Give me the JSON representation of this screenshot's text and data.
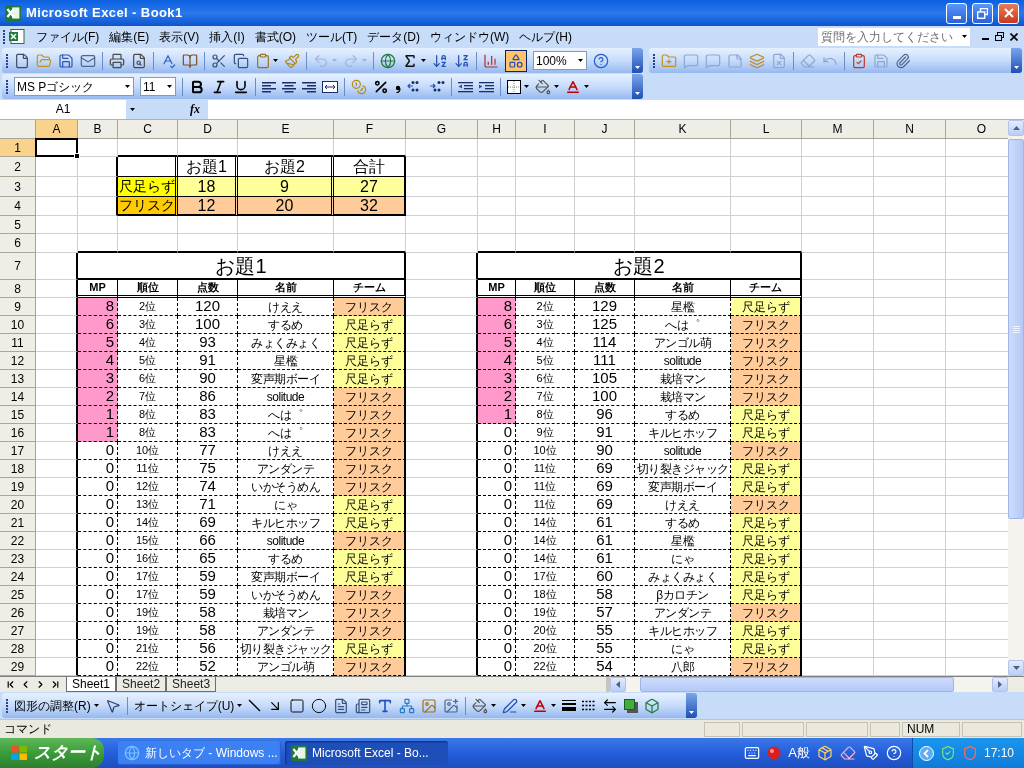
{
  "window": {
    "title": "Microsoft Excel - Book1"
  },
  "menu_bar": {
    "items": [
      "ファイル(F)",
      "編集(E)",
      "表示(V)",
      "挿入(I)",
      "書式(O)",
      "ツール(T)",
      "データ(D)",
      "ウィンドウ(W)",
      "ヘルプ(H)"
    ],
    "help_search": {
      "placeholder": "質問を入力してください"
    }
  },
  "standard_toolbar": {
    "zoom": "100%",
    "drawing_on": true,
    "undo_disabled": true,
    "redo_disabled": true
  },
  "formatting_toolbar": {
    "font": "MS Pゴシック",
    "size": "11"
  },
  "formula_bar": {
    "name_box": "A1",
    "function_label": "fx"
  },
  "sheet": {
    "columns": [
      {
        "label": "A",
        "selected": true
      },
      {
        "label": "B",
        "selected": false
      },
      {
        "label": "C",
        "selected": false
      },
      {
        "label": "D",
        "selected": false
      },
      {
        "label": "E",
        "selected": false
      },
      {
        "label": "F",
        "selected": false
      },
      {
        "label": "G",
        "selected": false
      },
      {
        "label": "H",
        "selected": false
      },
      {
        "label": "I",
        "selected": false
      },
      {
        "label": "J",
        "selected": false
      },
      {
        "label": "K",
        "selected": false
      },
      {
        "label": "L",
        "selected": false
      },
      {
        "label": "M",
        "selected": false
      },
      {
        "label": "N",
        "selected": false
      },
      {
        "label": "O",
        "selected": false
      }
    ],
    "rows": [
      {
        "label": "1",
        "selected": true
      },
      {
        "label": "2",
        "selected": false
      },
      {
        "label": "3",
        "selected": false
      },
      {
        "label": "4",
        "selected": false
      },
      {
        "label": "5",
        "selected": false
      },
      {
        "label": "6",
        "selected": false
      },
      {
        "label": "7",
        "selected": false
      },
      {
        "label": "8",
        "selected": false
      },
      {
        "label": "9",
        "selected": false
      },
      {
        "label": "10",
        "selected": false
      },
      {
        "label": "11",
        "selected": false
      },
      {
        "label": "12",
        "selected": false
      },
      {
        "label": "13",
        "selected": false
      },
      {
        "label": "14",
        "selected": false
      },
      {
        "label": "15",
        "selected": false
      },
      {
        "label": "16",
        "selected": false
      },
      {
        "label": "17",
        "selected": false
      },
      {
        "label": "18",
        "selected": false
      },
      {
        "label": "19",
        "selected": false
      },
      {
        "label": "20",
        "selected": false
      },
      {
        "label": "21",
        "selected": false
      },
      {
        "label": "22",
        "selected": false
      },
      {
        "label": "23",
        "selected": false
      },
      {
        "label": "24",
        "selected": false
      },
      {
        "label": "25",
        "selected": false
      },
      {
        "label": "26",
        "selected": false
      },
      {
        "label": "27",
        "selected": false
      },
      {
        "label": "28",
        "selected": false
      },
      {
        "label": "29",
        "selected": false
      }
    ]
  },
  "summary": {
    "headers": [
      "お題1",
      "お題2",
      "合計"
    ],
    "rows": [
      {
        "label": {
          "text": "尺足らず",
          "color": "#ffff00"
        },
        "color": "#ffff99",
        "values": [
          "18",
          "9",
          "27"
        ]
      },
      {
        "label": {
          "text": "フリスク",
          "color": "#ffcc00"
        },
        "color": "#ffcc99",
        "values": [
          "12",
          "20",
          "32"
        ]
      }
    ]
  },
  "rank_tables": [
    {
      "title": "お題1",
      "columns": [
        "MP",
        "順位",
        "点数",
        "名前",
        "チーム"
      ],
      "rows": [
        {
          "mp": "8",
          "highlighted": true,
          "rank": "2位",
          "score": "120",
          "name": "けええ",
          "team": "フリスク",
          "color": "#ffcc99"
        },
        {
          "mp": "6",
          "highlighted": true,
          "rank": "3位",
          "score": "100",
          "name": "するめ",
          "team": "尺足らず",
          "color": "#ffff99"
        },
        {
          "mp": "5",
          "highlighted": true,
          "rank": "4位",
          "score": "93",
          "name": "みょくみょく",
          "team": "尺足らず",
          "color": "#ffff99"
        },
        {
          "mp": "4",
          "highlighted": true,
          "rank": "5位",
          "score": "91",
          "name": "星檻",
          "team": "尺足らず",
          "color": "#ffff99"
        },
        {
          "mp": "3",
          "highlighted": true,
          "rank": "6位",
          "score": "90",
          "name": "変声期ボーイ",
          "team": "尺足らず",
          "color": "#ffff99"
        },
        {
          "mp": "2",
          "highlighted": true,
          "rank": "7位",
          "score": "86",
          "name": "solitude",
          "team": "フリスク",
          "color": "#ffcc99"
        },
        {
          "mp": "1",
          "highlighted": true,
          "rank": "8位",
          "score": "83",
          "name": "へは゜",
          "team": "フリスク",
          "color": "#ffcc99"
        },
        {
          "mp": "1",
          "highlighted": true,
          "rank": "8位",
          "score": "83",
          "name": "へは゜",
          "team": "フリスク",
          "color": "#ffcc99"
        },
        {
          "mp": "0",
          "highlighted": false,
          "rank": "10位",
          "score": "77",
          "name": "けええ",
          "team": "フリスク",
          "color": "#ffcc99"
        },
        {
          "mp": "0",
          "highlighted": false,
          "rank": "11位",
          "score": "75",
          "name": "アンダンテ",
          "team": "フリスク",
          "color": "#ffcc99"
        },
        {
          "mp": "0",
          "highlighted": false,
          "rank": "12位",
          "score": "74",
          "name": "いかそうめん",
          "team": "フリスク",
          "color": "#ffcc99"
        },
        {
          "mp": "0",
          "highlighted": false,
          "rank": "13位",
          "score": "71",
          "name": "にゃ",
          "team": "尺足らず",
          "color": "#ffff99"
        },
        {
          "mp": "0",
          "highlighted": false,
          "rank": "14位",
          "score": "69",
          "name": "キルヒホッフ",
          "team": "尺足らず",
          "color": "#ffff99"
        },
        {
          "mp": "0",
          "highlighted": false,
          "rank": "15位",
          "score": "66",
          "name": "solitude",
          "team": "フリスク",
          "color": "#ffcc99"
        },
        {
          "mp": "0",
          "highlighted": false,
          "rank": "16位",
          "score": "65",
          "name": "するめ",
          "team": "尺足らず",
          "color": "#ffff99"
        },
        {
          "mp": "0",
          "highlighted": false,
          "rank": "17位",
          "score": "59",
          "name": "変声期ボーイ",
          "team": "尺足らず",
          "color": "#ffff99"
        },
        {
          "mp": "0",
          "highlighted": false,
          "rank": "17位",
          "score": "59",
          "name": "いかそうめん",
          "team": "フリスク",
          "color": "#ffcc99"
        },
        {
          "mp": "0",
          "highlighted": false,
          "rank": "19位",
          "score": "58",
          "name": "栽培マン",
          "team": "フリスク",
          "color": "#ffcc99"
        },
        {
          "mp": "0",
          "highlighted": false,
          "rank": "19位",
          "score": "58",
          "name": "アンダンテ",
          "team": "フリスク",
          "color": "#ffcc99"
        },
        {
          "mp": "0",
          "highlighted": false,
          "rank": "21位",
          "score": "56",
          "name": "切り裂きジャック",
          "team": "尺足らず",
          "color": "#ffff99"
        },
        {
          "mp": "0",
          "highlighted": false,
          "rank": "22位",
          "score": "52",
          "name": "アンゴル萌",
          "team": "フリスク",
          "color": "#ffcc99"
        }
      ]
    },
    {
      "title": "お題2",
      "columns": [
        "MP",
        "順位",
        "点数",
        "名前",
        "チーム"
      ],
      "rows": [
        {
          "mp": "8",
          "highlighted": true,
          "rank": "2位",
          "score": "129",
          "name": "星檻",
          "team": "尺足らず",
          "color": "#ffff99"
        },
        {
          "mp": "6",
          "highlighted": true,
          "rank": "3位",
          "score": "125",
          "name": "へは゜",
          "team": "フリスク",
          "color": "#ffcc99"
        },
        {
          "mp": "5",
          "highlighted": true,
          "rank": "4位",
          "score": "114",
          "name": "アンゴル萌",
          "team": "フリスク",
          "color": "#ffcc99"
        },
        {
          "mp": "4",
          "highlighted": true,
          "rank": "5位",
          "score": "111",
          "name": "solitude",
          "team": "フリスク",
          "color": "#ffcc99"
        },
        {
          "mp": "3",
          "highlighted": true,
          "rank": "6位",
          "score": "105",
          "name": "栽培マン",
          "team": "フリスク",
          "color": "#ffcc99"
        },
        {
          "mp": "2",
          "highlighted": true,
          "rank": "7位",
          "score": "100",
          "name": "栽培マン",
          "team": "フリスク",
          "color": "#ffcc99"
        },
        {
          "mp": "1",
          "highlighted": true,
          "rank": "8位",
          "score": "96",
          "name": "するめ",
          "team": "尺足らず",
          "color": "#ffff99"
        },
        {
          "mp": "0",
          "highlighted": false,
          "rank": "9位",
          "score": "91",
          "name": "キルヒホッフ",
          "team": "尺足らず",
          "color": "#ffff99"
        },
        {
          "mp": "0",
          "highlighted": false,
          "rank": "10位",
          "score": "90",
          "name": "solitude",
          "team": "フリスク",
          "color": "#ffcc99"
        },
        {
          "mp": "0",
          "highlighted": false,
          "rank": "11位",
          "score": "69",
          "name": "切り裂きジャック",
          "team": "尺足らず",
          "color": "#ffff99"
        },
        {
          "mp": "0",
          "highlighted": false,
          "rank": "11位",
          "score": "69",
          "name": "変声期ボーイ",
          "team": "尺足らず",
          "color": "#ffff99"
        },
        {
          "mp": "0",
          "highlighted": false,
          "rank": "11位",
          "score": "69",
          "name": "けええ",
          "team": "フリスク",
          "color": "#ffcc99"
        },
        {
          "mp": "0",
          "highlighted": false,
          "rank": "14位",
          "score": "61",
          "name": "するめ",
          "team": "尺足らず",
          "color": "#ffff99"
        },
        {
          "mp": "0",
          "highlighted": false,
          "rank": "14位",
          "score": "61",
          "name": "星檻",
          "team": "尺足らず",
          "color": "#ffff99"
        },
        {
          "mp": "0",
          "highlighted": false,
          "rank": "14位",
          "score": "61",
          "name": "にゃ",
          "team": "尺足らず",
          "color": "#ffff99"
        },
        {
          "mp": "0",
          "highlighted": false,
          "rank": "17位",
          "score": "60",
          "name": "みょくみょく",
          "team": "尺足らず",
          "color": "#ffff99"
        },
        {
          "mp": "0",
          "highlighted": false,
          "rank": "18位",
          "score": "58",
          "name": "βカロチン",
          "team": "尺足らず",
          "color": "#ffff99"
        },
        {
          "mp": "0",
          "highlighted": false,
          "rank": "19位",
          "score": "57",
          "name": "アンダンテ",
          "team": "フリスク",
          "color": "#ffcc99"
        },
        {
          "mp": "0",
          "highlighted": false,
          "rank": "20位",
          "score": "55",
          "name": "キルヒホッフ",
          "team": "尺足らず",
          "color": "#ffff99"
        },
        {
          "mp": "0",
          "highlighted": false,
          "rank": "20位",
          "score": "55",
          "name": "にゃ",
          "team": "尺足らず",
          "color": "#ffff99"
        },
        {
          "mp": "0",
          "highlighted": false,
          "rank": "22位",
          "score": "54",
          "name": "八郎",
          "team": "フリスク",
          "color": "#ffcc99"
        }
      ]
    }
  ],
  "sheet_tabs": [
    {
      "label": "Sheet1",
      "selected": true
    },
    {
      "label": "Sheet2",
      "selected": false
    },
    {
      "label": "Sheet3",
      "selected": false
    }
  ],
  "drawing_toolbar": {
    "menus": [
      "図形の調整(R)",
      "オートシェイプ(U)"
    ]
  },
  "status_bar": {
    "mode": "コマンド",
    "indicators": [
      "NUM"
    ]
  },
  "taskbar": {
    "start": "スタート",
    "tasks": [
      {
        "kind": "browser",
        "label": "新しいタブ - Windows ...",
        "selected": false
      },
      {
        "kind": "spreadsheet",
        "label": "Microsoft Excel - Bo...",
        "selected": true
      }
    ],
    "ime": "A般",
    "clock": "17:10"
  }
}
